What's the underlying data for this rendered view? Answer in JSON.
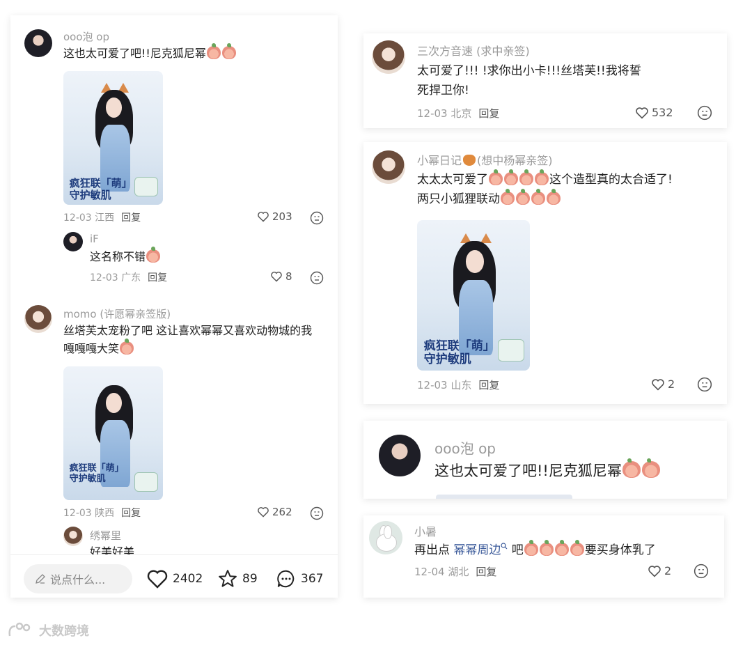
{
  "left_panel": {
    "comments": [
      {
        "user": "ooo泡 op",
        "text": "这也太可爱了吧!!尼克狐尼幂",
        "ad_slogan_line1": "疯狂联「萌」",
        "ad_slogan_line2": "守护敏肌",
        "date_loc": "12-03 江西",
        "reply_label": "回复",
        "likes": "203"
      },
      {
        "user": "iF",
        "text": "这名称不错",
        "date_loc": "12-03 广东",
        "reply_label": "回复",
        "likes": "8"
      },
      {
        "user": "momo (许愿幂亲签版)",
        "text_line1": "丝塔芙太宠粉了吧 这让喜欢幂幂又喜欢动物城的我",
        "text_line2": "嘎嘎嘎大笑",
        "ad_slogan_line1": "疯狂联「萌」",
        "ad_slogan_line2": "守护敏肌",
        "date_loc": "12-03 陕西",
        "reply_label": "回复",
        "likes": "262"
      },
      {
        "user": "绣幂里",
        "text": "好美好美"
      }
    ],
    "bottom_bar": {
      "input_placeholder": "说点什么...",
      "likes": "2402",
      "stars": "89",
      "comments": "367"
    }
  },
  "right_panel": {
    "card1": {
      "user": "三次方音速 (求中亲签)",
      "text_line1": "太可爱了!!! !求你出小卡!!!丝塔芙!!我将誓",
      "text_line2": "死捍卫你!",
      "date_loc": "12-03 北京",
      "reply_label": "回复",
      "likes": "532"
    },
    "card2": {
      "user_prefix": "小幂日记",
      "user_suffix": "(想中杨幂亲签)",
      "text_line1_a": "太太太可爱了",
      "text_line1_b": "这个造型真的太合适了!",
      "text_line2": "两只小狐狸联动",
      "ad_slogan_line1": "疯狂联「萌」",
      "ad_slogan_line2": "守护敏肌",
      "date_loc": "12-03 山东",
      "reply_label": "回复",
      "likes": "2"
    },
    "card3": {
      "user": "ooo泡 op",
      "text": "这也太可爱了吧!!尼克狐尼幂"
    },
    "card4": {
      "user": "小暑",
      "text_a": "再出点 ",
      "text_link": "幂幂周边",
      "text_b": " 吧",
      "text_c": "要买身体乳了",
      "date_loc": "12-04 湖北",
      "reply_label": "回复",
      "likes": "2"
    }
  },
  "watermark": "大数跨境",
  "colors": {
    "accent_text": "#222222",
    "muted": "#9a9a9a",
    "slogan": "#1e3c7d"
  }
}
